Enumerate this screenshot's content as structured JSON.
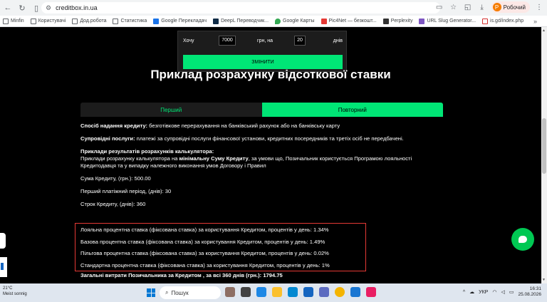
{
  "browser": {
    "url": "creditbox.in.ua",
    "profile_label": "Робочий",
    "profile_initial": "Р"
  },
  "bookmarks": [
    {
      "label": "Minfin",
      "icon": "folder-icon"
    },
    {
      "label": "Користувачі",
      "icon": "folder-icon"
    },
    {
      "label": "Дод.робота",
      "icon": "folder-icon"
    },
    {
      "label": "Статистика",
      "icon": "folder-icon"
    },
    {
      "label": "Google Перекладач",
      "icon": "translate-icon"
    },
    {
      "label": "DeepL Переводчик...",
      "icon": "deepl-icon"
    },
    {
      "label": "Google Карты",
      "icon": "map-pin-icon"
    },
    {
      "label": "Pic4Net — безкошт...",
      "icon": "pic4net-icon"
    },
    {
      "label": "Perplexity",
      "icon": "perplexity-icon"
    },
    {
      "label": "URL Slug Generator...",
      "icon": "slug-icon"
    },
    {
      "label": "is.gd/index.php",
      "icon": "isgd-icon"
    }
  ],
  "calculator": {
    "want_label": "Хочу",
    "amount_value": "7000",
    "mid_label": "грн, на",
    "days_value": "20",
    "days_label": "днів",
    "button_label": "ЗМІНИТИ"
  },
  "heading": "Приклад розрахунку відсоткової ставки",
  "tabs": [
    "Перший",
    "Повторний"
  ],
  "content": {
    "method_label": "Спосіб надання кредиту:",
    "method_text": " безготівкове перерахування на банківський рахунок або на банківську карту",
    "services_label": "Супровідні послуги:",
    "services_text": " платежі за супровідні послуги фінансової установи, кредитних посередників та третіх осіб не передбачені.",
    "examples_title": "Приклади результатів розрахунків калькулятора:",
    "examples_pre": "Приклади розрахунку калькулятора на ",
    "examples_bold": "мінімальну Суму Кредиту",
    "examples_post": ", за умови що, Позичальник користується Програмою лояльності Кредитодавця та у випадку належного виконання умов Договору і Правил",
    "loan_sum": "Сума Кредиту, (грн.): 500.00",
    "first_period": "Перший платіжний період, (днів): 30",
    "loan_term": "Строк Кредиту, (днів): 360",
    "rate_loyal": "Лояльна процентна ставка (фіксована ставка) за користування Кредитом, процентів у день: 1.34%",
    "rate_base": "Базова процентна ставка (фіксована ставка) за користування Кредитом, процентів у день: 1.49%",
    "rate_pref": "Пільгова процентна ставка (фіксована ставка) за користування Кредитом, процентів у день: 0.02%",
    "rate_std": "Стандартна процентна ставка (фіксована ставка) за користування Кредитом, процентів у день: 1%",
    "total_cost": "Загальні витрати Позичальника за Кредитом , за всі 360 днів (грн.): 1794.75"
  },
  "taskbar": {
    "weather_temp": "21°C",
    "weather_desc": "Meist sonnig",
    "search_label": "Пошук",
    "lang": "УКР",
    "time": "16:31",
    "date": "25.08.2026"
  },
  "colors": {
    "accent": "#00e676",
    "highlight_border": "#e53935",
    "page_bg": "#000000"
  }
}
